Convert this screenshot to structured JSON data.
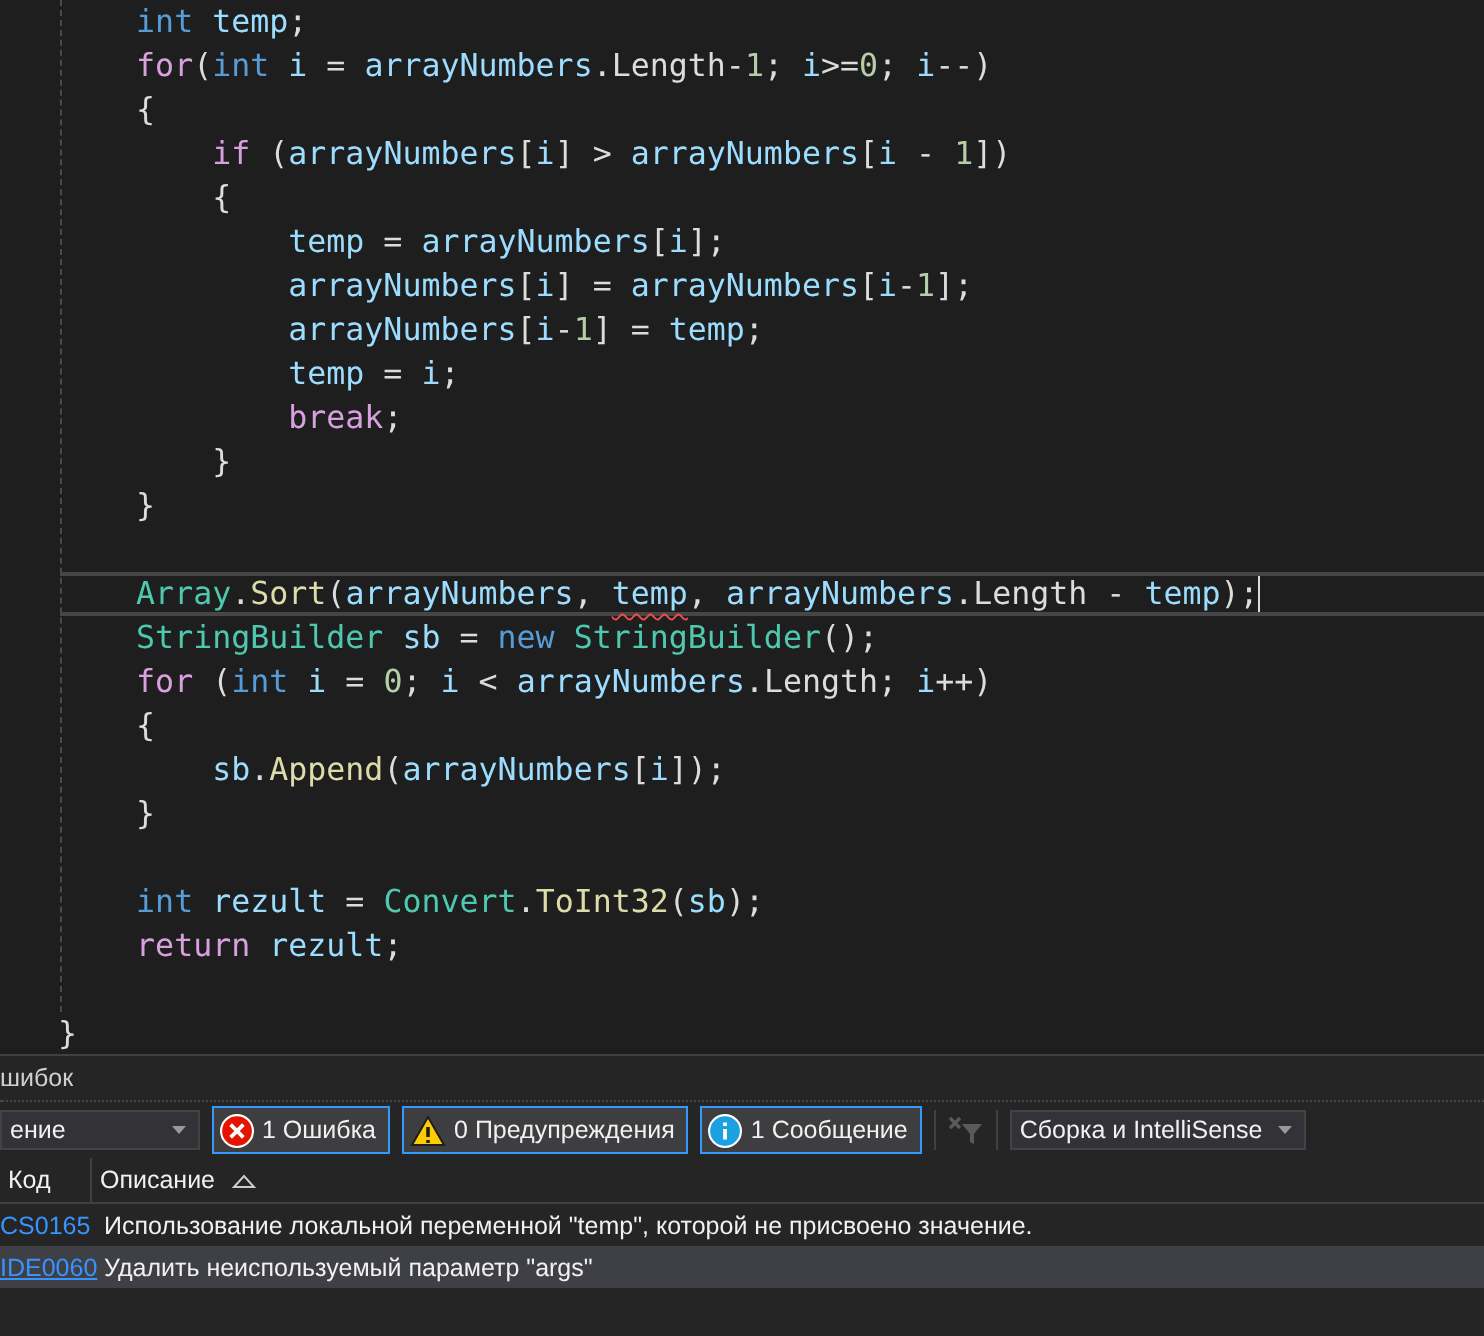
{
  "editor": {
    "lines": [
      {
        "current": false,
        "tokens": [
          {
            "kind": "keyword",
            "text": "    int "
          },
          {
            "kind": "variable",
            "text": "temp"
          },
          {
            "kind": "plain",
            "text": ";"
          }
        ]
      },
      {
        "current": false,
        "tokens": [
          {
            "kind": "control",
            "text": "    for"
          },
          {
            "kind": "plain",
            "text": "("
          },
          {
            "kind": "keyword",
            "text": "int "
          },
          {
            "kind": "variable",
            "text": "i"
          },
          {
            "kind": "plain",
            "text": " = "
          },
          {
            "kind": "variable",
            "text": "arrayNumbers"
          },
          {
            "kind": "plain",
            "text": ".Length-"
          },
          {
            "kind": "number",
            "text": "1"
          },
          {
            "kind": "plain",
            "text": "; "
          },
          {
            "kind": "variable",
            "text": "i"
          },
          {
            "kind": "plain",
            "text": ">="
          },
          {
            "kind": "number",
            "text": "0"
          },
          {
            "kind": "plain",
            "text": "; "
          },
          {
            "kind": "variable",
            "text": "i"
          },
          {
            "kind": "plain",
            "text": "--)"
          }
        ]
      },
      {
        "current": false,
        "tokens": [
          {
            "kind": "plain",
            "text": "    {"
          }
        ]
      },
      {
        "current": false,
        "tokens": [
          {
            "kind": "control",
            "text": "        if "
          },
          {
            "kind": "plain",
            "text": "("
          },
          {
            "kind": "variable",
            "text": "arrayNumbers"
          },
          {
            "kind": "plain",
            "text": "["
          },
          {
            "kind": "variable",
            "text": "i"
          },
          {
            "kind": "plain",
            "text": "] > "
          },
          {
            "kind": "variable",
            "text": "arrayNumbers"
          },
          {
            "kind": "plain",
            "text": "["
          },
          {
            "kind": "variable",
            "text": "i"
          },
          {
            "kind": "plain",
            "text": " - "
          },
          {
            "kind": "number",
            "text": "1"
          },
          {
            "kind": "plain",
            "text": "])"
          }
        ]
      },
      {
        "current": false,
        "tokens": [
          {
            "kind": "plain",
            "text": "        {"
          }
        ]
      },
      {
        "current": false,
        "tokens": [
          {
            "kind": "variable",
            "text": "            temp"
          },
          {
            "kind": "plain",
            "text": " = "
          },
          {
            "kind": "variable",
            "text": "arrayNumbers"
          },
          {
            "kind": "plain",
            "text": "["
          },
          {
            "kind": "variable",
            "text": "i"
          },
          {
            "kind": "plain",
            "text": "];"
          }
        ]
      },
      {
        "current": false,
        "tokens": [
          {
            "kind": "variable",
            "text": "            arrayNumbers"
          },
          {
            "kind": "plain",
            "text": "["
          },
          {
            "kind": "variable",
            "text": "i"
          },
          {
            "kind": "plain",
            "text": "] = "
          },
          {
            "kind": "variable",
            "text": "arrayNumbers"
          },
          {
            "kind": "plain",
            "text": "["
          },
          {
            "kind": "variable",
            "text": "i"
          },
          {
            "kind": "plain",
            "text": "-"
          },
          {
            "kind": "number",
            "text": "1"
          },
          {
            "kind": "plain",
            "text": "];"
          }
        ]
      },
      {
        "current": false,
        "tokens": [
          {
            "kind": "variable",
            "text": "            arrayNumbers"
          },
          {
            "kind": "plain",
            "text": "["
          },
          {
            "kind": "variable",
            "text": "i"
          },
          {
            "kind": "plain",
            "text": "-"
          },
          {
            "kind": "number",
            "text": "1"
          },
          {
            "kind": "plain",
            "text": "] = "
          },
          {
            "kind": "variable",
            "text": "temp"
          },
          {
            "kind": "plain",
            "text": ";"
          }
        ]
      },
      {
        "current": false,
        "tokens": [
          {
            "kind": "variable",
            "text": "            temp"
          },
          {
            "kind": "plain",
            "text": " = "
          },
          {
            "kind": "variable",
            "text": "i"
          },
          {
            "kind": "plain",
            "text": ";"
          }
        ]
      },
      {
        "current": false,
        "tokens": [
          {
            "kind": "control",
            "text": "            break"
          },
          {
            "kind": "plain",
            "text": ";"
          }
        ]
      },
      {
        "current": false,
        "tokens": [
          {
            "kind": "plain",
            "text": "        }"
          }
        ]
      },
      {
        "current": false,
        "tokens": [
          {
            "kind": "plain",
            "text": "    }"
          }
        ]
      },
      {
        "current": false
      },
      {
        "current": true,
        "tokens": [
          {
            "kind": "type",
            "text": "    Array"
          },
          {
            "kind": "plain",
            "text": "."
          },
          {
            "kind": "method",
            "text": "Sort"
          },
          {
            "kind": "plain",
            "text": "("
          },
          {
            "kind": "variable",
            "text": "arrayNumbers"
          },
          {
            "kind": "plain",
            "text": ", "
          },
          {
            "kind": "variable",
            "text": "temp",
            "error": true
          },
          {
            "kind": "plain",
            "text": ", "
          },
          {
            "kind": "variable",
            "text": "arrayNumbers"
          },
          {
            "kind": "plain",
            "text": ".Length - "
          },
          {
            "kind": "variable",
            "text": "temp"
          },
          {
            "kind": "plain",
            "text": ");"
          }
        ]
      },
      {
        "current": false,
        "tokens": [
          {
            "kind": "type",
            "text": "    StringBuilder "
          },
          {
            "kind": "variable",
            "text": "sb"
          },
          {
            "kind": "plain",
            "text": " = "
          },
          {
            "kind": "keyword",
            "text": "new "
          },
          {
            "kind": "type",
            "text": "StringBuilder"
          },
          {
            "kind": "plain",
            "text": "();"
          }
        ]
      },
      {
        "current": false,
        "tokens": [
          {
            "kind": "control",
            "text": "    for "
          },
          {
            "kind": "plain",
            "text": "("
          },
          {
            "kind": "keyword",
            "text": "int "
          },
          {
            "kind": "variable",
            "text": "i"
          },
          {
            "kind": "plain",
            "text": " = "
          },
          {
            "kind": "number",
            "text": "0"
          },
          {
            "kind": "plain",
            "text": "; "
          },
          {
            "kind": "variable",
            "text": "i"
          },
          {
            "kind": "plain",
            "text": " < "
          },
          {
            "kind": "variable",
            "text": "arrayNumbers"
          },
          {
            "kind": "plain",
            "text": ".Length; "
          },
          {
            "kind": "variable",
            "text": "i"
          },
          {
            "kind": "plain",
            "text": "++)"
          }
        ]
      },
      {
        "current": false,
        "tokens": [
          {
            "kind": "plain",
            "text": "    {"
          }
        ]
      },
      {
        "current": false,
        "tokens": [
          {
            "kind": "variable",
            "text": "        sb"
          },
          {
            "kind": "plain",
            "text": "."
          },
          {
            "kind": "method",
            "text": "Append"
          },
          {
            "kind": "plain",
            "text": "("
          },
          {
            "kind": "variable",
            "text": "arrayNumbers"
          },
          {
            "kind": "plain",
            "text": "["
          },
          {
            "kind": "variable",
            "text": "i"
          },
          {
            "kind": "plain",
            "text": "]);"
          }
        ]
      },
      {
        "current": false,
        "tokens": [
          {
            "kind": "plain",
            "text": "    }"
          }
        ]
      },
      {
        "current": false
      },
      {
        "current": false,
        "tokens": [
          {
            "kind": "keyword",
            "text": "    int "
          },
          {
            "kind": "variable",
            "text": "rezult"
          },
          {
            "kind": "plain",
            "text": " = "
          },
          {
            "kind": "type",
            "text": "Convert"
          },
          {
            "kind": "plain",
            "text": "."
          },
          {
            "kind": "method",
            "text": "ToInt32"
          },
          {
            "kind": "plain",
            "text": "("
          },
          {
            "kind": "variable",
            "text": "sb"
          },
          {
            "kind": "plain",
            "text": ");"
          }
        ]
      },
      {
        "current": false,
        "tokens": [
          {
            "kind": "control",
            "text": "    return "
          },
          {
            "kind": "variable",
            "text": "rezult"
          },
          {
            "kind": "plain",
            "text": ";"
          }
        ]
      },
      {
        "current": false
      }
    ],
    "closing_line": "}"
  },
  "error_list": {
    "title": "шибок",
    "scope_dropdown": "ение",
    "filters": [
      {
        "kind": "error",
        "label": "1 Ошибка",
        "selected": true
      },
      {
        "kind": "warning",
        "label": "0 Предупреждения",
        "selected": true
      },
      {
        "kind": "info",
        "label": "1 Сообщение",
        "selected": true
      }
    ],
    "source_dropdown": "Сборка и IntelliSense",
    "columns": [
      "Код",
      "Описание"
    ],
    "rows": [
      {
        "code": "CS0165",
        "description": "Использование локальной переменной \"temp\", которой не присвоено значение.",
        "selected": false
      },
      {
        "code": "IDE0060",
        "description": "Удалить неиспользуемый параметр \"args\"",
        "selected": true
      }
    ]
  }
}
